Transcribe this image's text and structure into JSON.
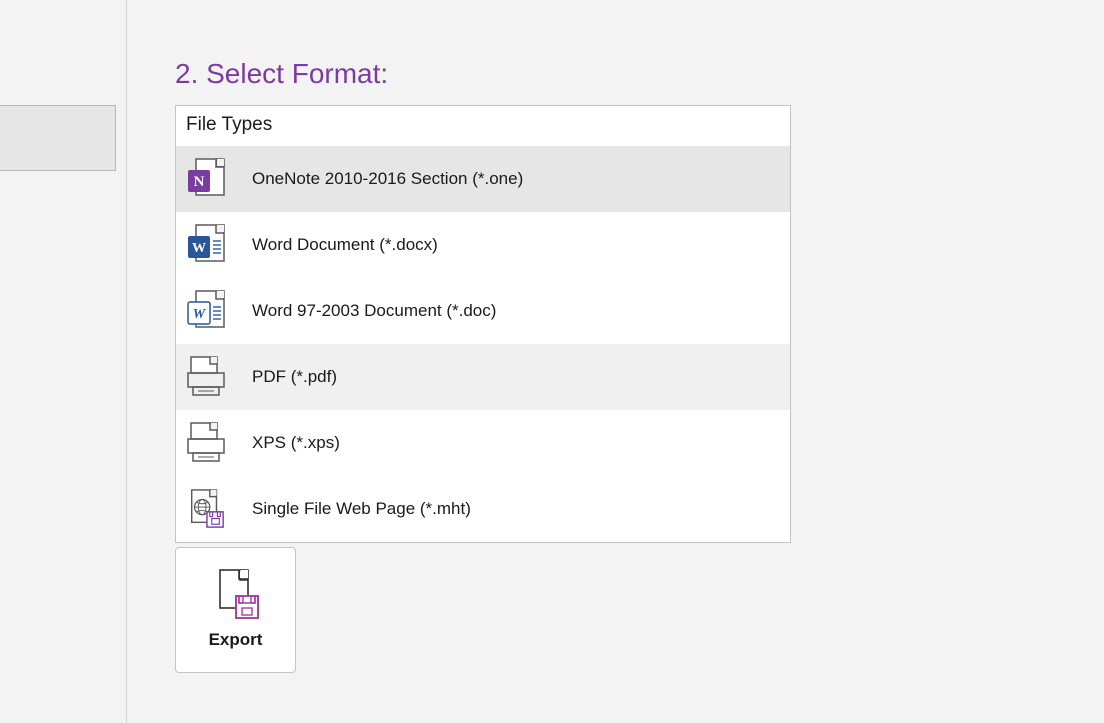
{
  "section_title": "2. Select Format:",
  "file_types_header": "File Types",
  "file_types": [
    {
      "label": "OneNote 2010-2016 Section (*.one)",
      "icon": "onenote",
      "selected": true
    },
    {
      "label": "Word Document (*.docx)",
      "icon": "word",
      "selected": false
    },
    {
      "label": "Word 97-2003 Document (*.doc)",
      "icon": "word-legacy",
      "selected": false
    },
    {
      "label": "PDF (*.pdf)",
      "icon": "pdf",
      "selected": false
    },
    {
      "label": "XPS (*.xps)",
      "icon": "xps",
      "selected": false
    },
    {
      "label": "Single File Web Page (*.mht)",
      "icon": "mht",
      "selected": false
    }
  ],
  "export_button_label": "Export"
}
